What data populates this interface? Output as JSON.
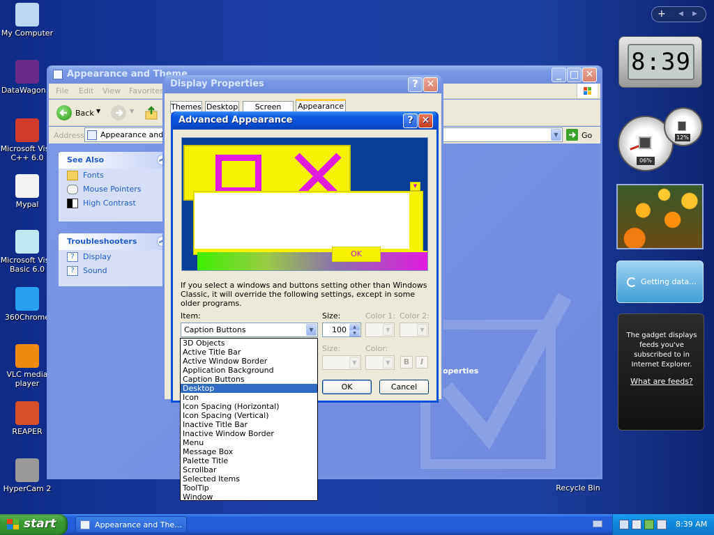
{
  "desktop": {
    "icons": [
      {
        "label": "My Computer",
        "icon": "my-computer-icon"
      },
      {
        "label": "DataWagon...",
        "icon": "datawagon-icon"
      },
      {
        "label": "Microsoft Visu C++ 6.0",
        "icon": "visual-cpp-icon"
      },
      {
        "label": "Mypal",
        "icon": "mypal-icon"
      },
      {
        "label": "Microsoft Visu Basic 6.0",
        "icon": "visual-basic-icon"
      },
      {
        "label": "360Chrome",
        "icon": "360chrome-icon"
      },
      {
        "label": "VLC media player",
        "icon": "vlc-icon"
      },
      {
        "label": "REAPER",
        "icon": "reaper-icon"
      },
      {
        "label": "HyperCam 2",
        "icon": "hypercam-icon"
      }
    ],
    "recycle_bin": "Recycle Bin"
  },
  "explorer": {
    "title": "Appearance and Theme",
    "menu": [
      "File",
      "Edit",
      "View",
      "Favorites"
    ],
    "back_label": "Back",
    "address_label": "Address",
    "address_value": "Appearance and Th",
    "go_label": "Go",
    "see_also": {
      "heading": "See Also",
      "items": [
        "Fonts",
        "Mouse Pointers",
        "High Contrast"
      ]
    },
    "troubleshooters": {
      "heading": "Troubleshooters",
      "items": [
        "Display",
        "Sound"
      ]
    },
    "peek_text": "operties"
  },
  "display_props": {
    "title": "Display Properties",
    "tabs": [
      "Themes",
      "Desktop",
      "Screen Saver",
      "Appearance"
    ]
  },
  "advanced": {
    "title": "Advanced Appearance",
    "preview_ok": "OK",
    "info": "If you select a windows and buttons setting other than Windows Classic, it will override the following settings, except in some older programs.",
    "item_label": "Item:",
    "size_label": "Size:",
    "color1_label": "Color 1:",
    "color2_label": "Color 2:",
    "item_value": "Caption Buttons",
    "size_value": "100",
    "font_size_label": "Size:",
    "font_color_label": "Color:",
    "bold": "B",
    "italic": "I",
    "ok": "OK",
    "cancel": "Cancel",
    "items": [
      "3D Objects",
      "Active Title Bar",
      "Active Window Border",
      "Application Background",
      "Caption Buttons",
      "Desktop",
      "Icon",
      "Icon Spacing (Horizontal)",
      "Icon Spacing (Vertical)",
      "Inactive Title Bar",
      "Inactive Window Border",
      "Menu",
      "Message Box",
      "Palette Title",
      "Scrollbar",
      "Selected Items",
      "ToolTip",
      "Window"
    ],
    "highlighted_item": "Desktop"
  },
  "sidebar": {
    "clock": "8:39",
    "cpu_percent": "06%",
    "mem_percent": "12%",
    "getting_data": "Getting data...",
    "feeds_text": "The gadget displays feeds you've subscribed to in Internet Explorer.",
    "feeds_link": "What are feeds?"
  },
  "taskbar": {
    "start": "start",
    "task": "Appearance and The...",
    "time": "8:39 AM"
  }
}
